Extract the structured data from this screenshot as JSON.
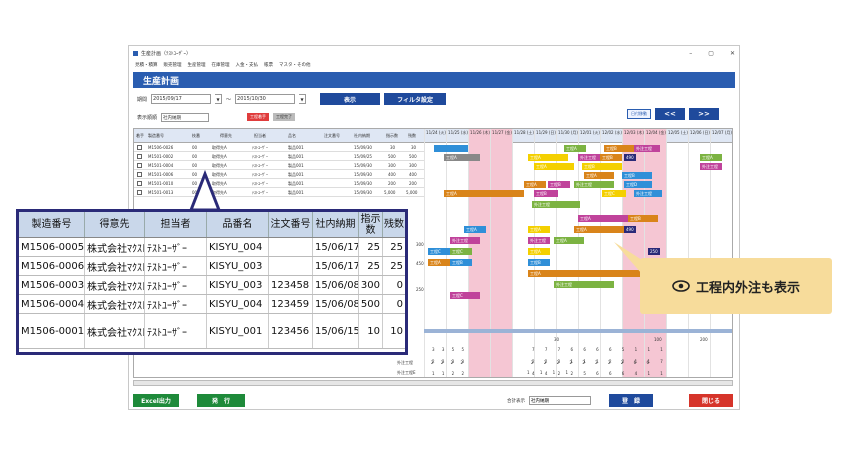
{
  "window": {
    "title": "生産計画（ﾃｽﾄﾕｰｻﾞｰ）",
    "controls": [
      "–",
      "▢",
      "✕"
    ]
  },
  "menu": [
    "見積・積算",
    "販売管理",
    "生産管理",
    "在庫管理",
    "入金・支払",
    "帳票",
    "マスタ・その他"
  ],
  "banner": {
    "title": "生産計画"
  },
  "filter": {
    "period_label": "期間",
    "date_from": "2015/09/17",
    "tilde": "～",
    "date_to": "2015/10/30",
    "show_label": "表示",
    "filter_label": "フィルタ設定"
  },
  "row2": {
    "order_label": "表示順順",
    "order_value": "社内納期",
    "pill_red": "工程着手",
    "pill_gray": "工程完了"
  },
  "nav": {
    "today": "日付移動",
    "prev": "<<",
    "next": ">>"
  },
  "grid": {
    "headers": [
      "着手",
      "製造番号",
      "枝番",
      "得意先",
      "担当者",
      "品名",
      "注文番号",
      "社内納期",
      "指示数",
      "残数"
    ],
    "rows": [
      [
        "M1506-0026",
        "00",
        "取得先A",
        "ﾃｽﾄﾕｰｻﾞｰ",
        "製品001",
        "",
        "15/09/30",
        "30",
        "30"
      ],
      [
        "M1501-0002",
        "00",
        "取得先A",
        "ﾃｽﾄﾕｰｻﾞｰ",
        "製品001",
        "",
        "15/09/25",
        "500",
        "500"
      ],
      [
        "M1501-0004",
        "00",
        "取得先A",
        "ﾃｽﾄﾕｰｻﾞｰ",
        "製品001",
        "",
        "15/09/30",
        "300",
        "300"
      ],
      [
        "M1501-0006",
        "00",
        "取得先A",
        "ﾃｽﾄﾕｰｻﾞｰ",
        "製品001",
        "",
        "15/09/30",
        "400",
        "400"
      ],
      [
        "M1501-0010",
        "00",
        "取得先A",
        "ﾃｽﾄﾕｰｻﾞｰ",
        "製品001",
        "",
        "15/09/30",
        "200",
        "200"
      ],
      [
        "M1501-0013",
        "00",
        "取得先A",
        "ﾃｽﾄﾕｰｻﾞｰ",
        "製品001",
        "",
        "15/09/30",
        "5,000",
        "5,000"
      ]
    ],
    "days": [
      "11/24 (火)",
      "11/25 (水)",
      "11/26 (木)",
      "11/27 (金)",
      "11/28 (土)",
      "11/29 (日)",
      "11/30 (月)",
      "12/01 (火)",
      "12/02 (水)",
      "12/03 (木)",
      "12/04 (金)",
      "12/05 (土)",
      "12/06 (日)",
      "12/07 (月)"
    ],
    "bar_labels": [
      "工程A",
      "工程B",
      "工程C",
      "外注工程",
      "工程D"
    ],
    "bar_value": "490",
    "bar_value2": "250",
    "side_values": [
      "300",
      "450",
      "250"
    ],
    "sum_labels": [
      "外注工程",
      "外注工程E"
    ],
    "sum_header_a": "30",
    "sum_header_b": "100",
    "sum_header_c": "200",
    "sum_row_1": [
      "7",
      "7",
      "7",
      "6",
      "6",
      "6",
      "6",
      "5",
      "",
      "1",
      "1",
      "1"
    ],
    "sum_row_2": [
      "2",
      "2",
      "3",
      "1",
      "1",
      "1",
      "2",
      "2",
      "",
      "1",
      "1",
      "7"
    ],
    "sum_row_3": [
      "4",
      "4",
      "2",
      "2",
      "5",
      "6",
      "6",
      "6",
      "4",
      "",
      "1",
      "1"
    ],
    "sum_row_4": [
      "2",
      "2",
      "2",
      "2",
      "2",
      "2",
      "2",
      "2",
      "",
      "6",
      "6"
    ],
    "sum_row_5": [
      "1",
      "1",
      "1",
      "1"
    ],
    "left_sum_1": [
      "3",
      "3",
      "5",
      "5"
    ],
    "left_sum_2": [
      "2",
      "3",
      "3",
      "3"
    ],
    "left_sum_3": [
      "1",
      "1",
      "2",
      "2"
    ],
    "left_sum_4": [
      "2",
      "2",
      "2",
      "2"
    ]
  },
  "footer": {
    "excel": "Excel出力",
    "print": "発　行",
    "total_label": "合計表示",
    "total_value": "社内納期",
    "register": "登　録",
    "close": "閉じる"
  },
  "zoom": {
    "headers": [
      "製造番号",
      "得意先",
      "担当者",
      "品番名",
      "注文番号",
      "社内納期",
      "指示数",
      "残数"
    ],
    "rows": [
      [
        "M1506-0005",
        "株式会社ﾏｸｽﾄｻｲｴﾝｽ",
        "ﾃｽﾄﾕｰｻﾞｰ",
        "KISYU_004",
        "",
        "15/06/17",
        "25",
        "25"
      ],
      [
        "M1506-0006",
        "株式会社ﾏｸｽﾄｻｲｴﾝｽ",
        "ﾃｽﾄﾕｰｻﾞｰ",
        "KISYU_003",
        "",
        "15/06/17",
        "25",
        "25"
      ],
      [
        "M1506-0003",
        "株式会社ﾏｸｽﾄｻｲｴﾝｽ",
        "ﾃｽﾄﾕｰｻﾞｰ",
        "KISYU_003",
        "123458",
        "15/06/08",
        "300",
        "0"
      ],
      [
        "M1506-0004",
        "株式会社ﾏｸｽﾄｻｲｴﾝｽ",
        "ﾃｽﾄﾕｰｻﾞｰ",
        "KISYU_004",
        "123459",
        "15/06/08",
        "500",
        "0"
      ],
      [
        "M1506-0001",
        "株式会社ﾏｸｽﾄｻｲｴﾝｽ",
        "ﾃｽﾄﾕｰｻﾞｰ",
        "KISYU_001",
        "123456",
        "15/06/15",
        "10",
        "10"
      ]
    ]
  },
  "callout": {
    "text": "工程内外注も表示",
    "icon": "eye-icon"
  },
  "colors": {
    "navy": "#1f4a9c",
    "pink": "#f5c6d3",
    "orange": "#d9841a",
    "green": "#7cb342",
    "yellow": "#f4d000",
    "blue": "#2f8fd8",
    "magenta": "#c0439b",
    "callout": "#f7dc9b"
  }
}
